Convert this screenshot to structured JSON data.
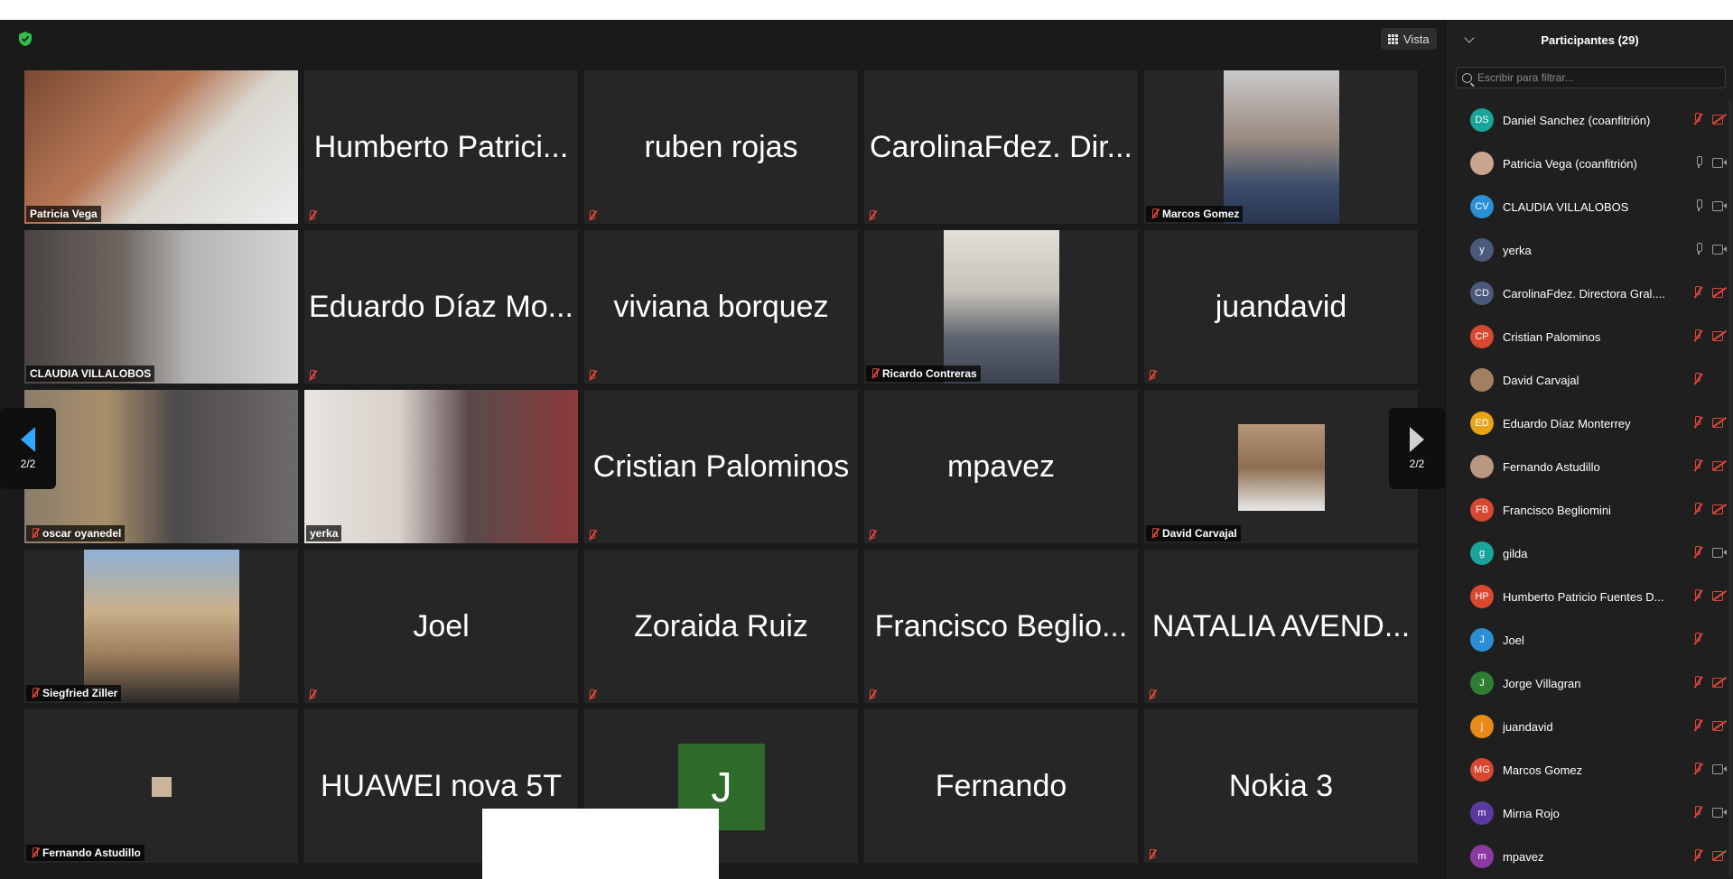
{
  "toolbar": {
    "view_label": "Vista"
  },
  "navigation": {
    "page_indicator_left": "2/2",
    "page_indicator_right": "2/2"
  },
  "tiles": [
    {
      "kind": "video",
      "label": "Patricia Vega",
      "muted": false,
      "active": true,
      "photo": "ph-patricia"
    },
    {
      "kind": "name",
      "name": "Humberto Patrici...",
      "muted": true
    },
    {
      "kind": "name",
      "name": "ruben rojas",
      "muted": true
    },
    {
      "kind": "name",
      "name": "CarolinaFdez. Dir...",
      "muted": true
    },
    {
      "kind": "video",
      "label": "Marcos Gomez",
      "muted": true,
      "photo": "ph-marcos"
    },
    {
      "kind": "video",
      "label": "CLAUDIA VILLALOBOS",
      "muted": false,
      "photo": "ph-claudia"
    },
    {
      "kind": "name",
      "name": "Eduardo Díaz Mo...",
      "muted": true
    },
    {
      "kind": "name",
      "name": "viviana borquez",
      "muted": true
    },
    {
      "kind": "video",
      "label": "Ricardo Contreras",
      "muted": true,
      "photo": "ph-ricardo"
    },
    {
      "kind": "name",
      "name": "juandavid",
      "muted": true
    },
    {
      "kind": "video",
      "label": "oscar oyanedel",
      "muted": true,
      "photo": "ph-oscar"
    },
    {
      "kind": "video",
      "label": "yerka",
      "muted": false,
      "photo": "ph-yerka"
    },
    {
      "kind": "name",
      "name": "Cristian Palominos",
      "muted": true
    },
    {
      "kind": "name",
      "name": "mpavez",
      "muted": true
    },
    {
      "kind": "video",
      "label": "David Carvajal",
      "muted": true,
      "photo": "ph-david"
    },
    {
      "kind": "video",
      "label": "Siegfried Ziller",
      "muted": true,
      "photo": "ph-siegfried"
    },
    {
      "kind": "name",
      "name": "Joel",
      "muted": true
    },
    {
      "kind": "name",
      "name": "Zoraida Ruiz",
      "muted": true
    },
    {
      "kind": "name",
      "name": "Francisco Beglio...",
      "muted": true
    },
    {
      "kind": "name",
      "name": "NATALIA AVEND...",
      "muted": true
    },
    {
      "kind": "video",
      "label": "Fernando Astudillo",
      "muted": true,
      "photo": "ph-fernando-a"
    },
    {
      "kind": "name",
      "name": "HUAWEI nova 5T",
      "muted": false
    },
    {
      "kind": "avatar",
      "initial": "J",
      "muted": false
    },
    {
      "kind": "name",
      "name": "Fernando",
      "muted": false
    },
    {
      "kind": "name",
      "name": "Nokia 3",
      "muted": true
    }
  ],
  "participants_panel": {
    "title": "Participantes (29)",
    "filter_placeholder": "Escribir para filtrar...",
    "participants": [
      {
        "initials": "DS",
        "color": "#1aa39a",
        "name": "Daniel Sanchez (coanfitrión)",
        "mic": "off",
        "cam": "off"
      },
      {
        "initials": "",
        "color": "#c9a58d",
        "name": "Patricia Vega (coanfitrión)",
        "mic": "on",
        "cam": "on"
      },
      {
        "initials": "CV",
        "color": "#2b8fd6",
        "name": "CLAUDIA VILLALOBOS",
        "mic": "on",
        "cam": "on"
      },
      {
        "initials": "y",
        "color": "#4a5a78",
        "name": "yerka",
        "mic": "on",
        "cam": "on"
      },
      {
        "initials": "CD",
        "color": "#4a5a78",
        "name": "CarolinaFdez. Directora Gral....",
        "mic": "off",
        "cam": "off"
      },
      {
        "initials": "CP",
        "color": "#d8472f",
        "name": "Cristian Palominos",
        "mic": "off",
        "cam": "off"
      },
      {
        "initials": "",
        "color": "#a08060",
        "name": "David Carvajal",
        "mic": "off",
        "cam": "none"
      },
      {
        "initials": "ED",
        "color": "#e8a317",
        "name": "Eduardo Díaz Monterrey",
        "mic": "off",
        "cam": "off"
      },
      {
        "initials": "",
        "color": "#b89880",
        "name": "Fernando Astudillo",
        "mic": "off",
        "cam": "off"
      },
      {
        "initials": "FB",
        "color": "#d8472f",
        "name": "Francisco Begliomini",
        "mic": "off",
        "cam": "off"
      },
      {
        "initials": "g",
        "color": "#1aa39a",
        "name": "gilda",
        "mic": "off",
        "cam": "on"
      },
      {
        "initials": "HP",
        "color": "#d8472f",
        "name": "Humberto Patricio Fuentes D...",
        "mic": "off",
        "cam": "off"
      },
      {
        "initials": "J",
        "color": "#2b8fd6",
        "name": "Joel",
        "mic": "off",
        "cam": "none"
      },
      {
        "initials": "J",
        "color": "#2e7d32",
        "name": "Jorge Villagran",
        "mic": "off",
        "cam": "off"
      },
      {
        "initials": "j",
        "color": "#e88a17",
        "name": "juandavid",
        "mic": "off",
        "cam": "off"
      },
      {
        "initials": "MG",
        "color": "#d8472f",
        "name": "Marcos Gomez",
        "mic": "off",
        "cam": "on"
      },
      {
        "initials": "m",
        "color": "#5a3aa0",
        "name": "Mirna Rojo",
        "mic": "off",
        "cam": "on"
      },
      {
        "initials": "m",
        "color": "#8a3aa0",
        "name": "mpavez",
        "mic": "off",
        "cam": "off"
      }
    ]
  }
}
